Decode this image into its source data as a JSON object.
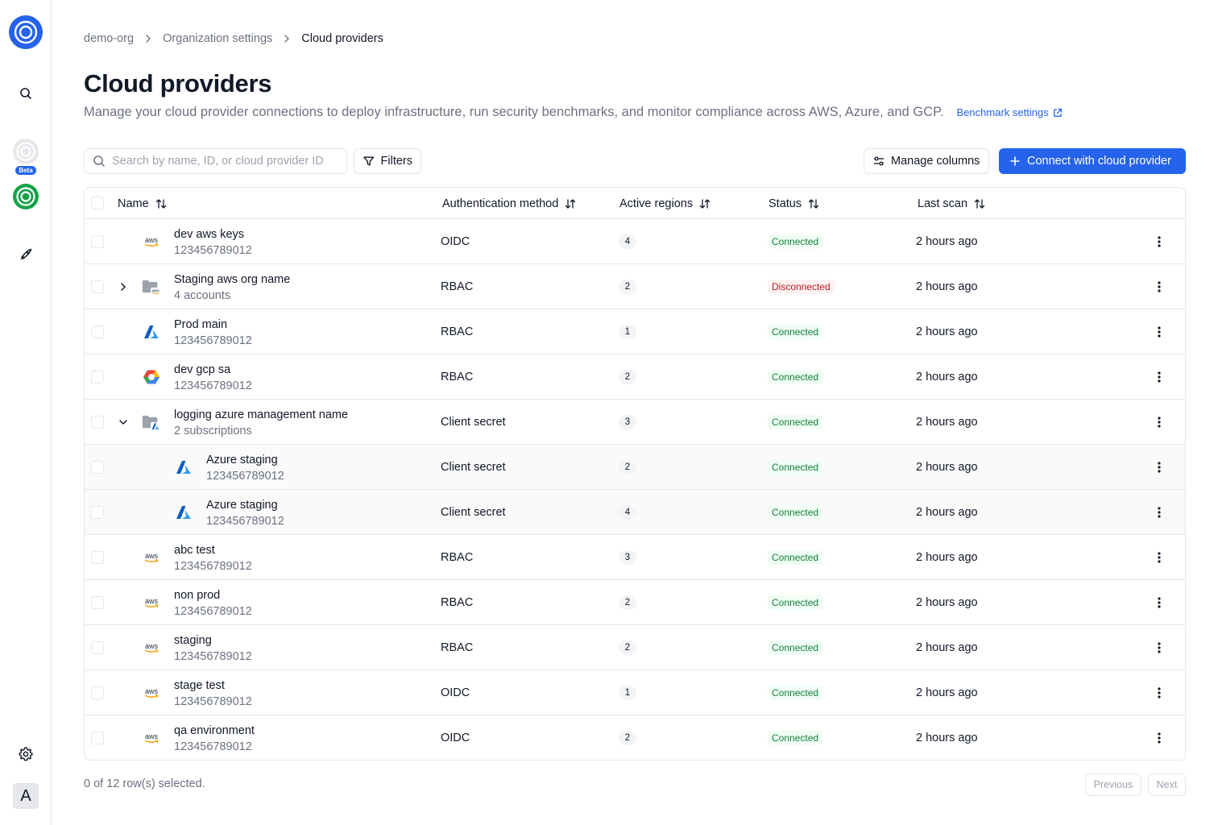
{
  "rail": {
    "beta_label": "Beta",
    "avatar_initial": "A",
    "icons": [
      "logo-icon",
      "search-icon",
      "app-icon",
      "app-icon",
      "rocket-icon",
      "gear-icon"
    ]
  },
  "breadcrumb": [
    "demo-org",
    "Organization settings",
    "Cloud providers"
  ],
  "page": {
    "title": "Cloud providers",
    "description": "Manage your cloud provider connections to deploy infrastructure, run security benchmarks, and monitor compliance across AWS, Azure, and GCP.",
    "benchmark_link": "Benchmark settings"
  },
  "toolbar": {
    "search_placeholder": "Search by name, ID, or cloud provider ID",
    "filters_label": "Filters",
    "manage_columns_label": "Manage columns",
    "connect_label": "Connect with cloud provider"
  },
  "table": {
    "columns": [
      "Name",
      "Authentication method",
      "Active regions",
      "Status",
      "Last scan"
    ],
    "rows": [
      {
        "provider": "aws",
        "name": "dev aws keys",
        "sub": "123456789012",
        "auth": "OIDC",
        "regions": "4",
        "status": "Connected",
        "status_ok": true,
        "scan": "2 hours ago"
      },
      {
        "provider": "aws-org",
        "expand": "collapsed",
        "name": "Staging aws org name",
        "sub": "4 accounts",
        "auth": "RBAC",
        "regions": "2",
        "status": "Disconnected",
        "status_ok": false,
        "scan": "2 hours ago"
      },
      {
        "provider": "azure",
        "name": "Prod main",
        "sub": "123456789012",
        "auth": "RBAC",
        "regions": "1",
        "status": "Connected",
        "status_ok": true,
        "scan": "2 hours ago"
      },
      {
        "provider": "gcp",
        "name": "dev gcp sa",
        "sub": "123456789012",
        "auth": "RBAC",
        "regions": "2",
        "status": "Connected",
        "status_ok": true,
        "scan": "2 hours ago"
      },
      {
        "provider": "azure-org",
        "expand": "expanded",
        "name": "logging azure management name",
        "sub": "2 subscriptions",
        "auth": "Client secret",
        "regions": "3",
        "status": "Connected",
        "status_ok": true,
        "scan": "2 hours ago"
      },
      {
        "provider": "azure",
        "child": true,
        "name": "Azure staging",
        "sub": "123456789012",
        "auth": "Client secret",
        "regions": "2",
        "status": "Connected",
        "status_ok": true,
        "scan": "2 hours ago"
      },
      {
        "provider": "azure",
        "child": true,
        "name": "Azure staging",
        "sub": "123456789012",
        "auth": "Client secret",
        "regions": "4",
        "status": "Connected",
        "status_ok": true,
        "scan": "2 hours ago"
      },
      {
        "provider": "aws",
        "name": "abc test",
        "sub": "123456789012",
        "auth": "RBAC",
        "regions": "3",
        "status": "Connected",
        "status_ok": true,
        "scan": "2 hours ago"
      },
      {
        "provider": "aws",
        "name": "non prod",
        "sub": "123456789012",
        "auth": "RBAC",
        "regions": "2",
        "status": "Connected",
        "status_ok": true,
        "scan": "2 hours ago"
      },
      {
        "provider": "aws",
        "name": "staging",
        "sub": "123456789012",
        "auth": "RBAC",
        "regions": "2",
        "status": "Connected",
        "status_ok": true,
        "scan": "2 hours ago"
      },
      {
        "provider": "aws",
        "name": "stage test",
        "sub": "123456789012",
        "auth": "OIDC",
        "regions": "1",
        "status": "Connected",
        "status_ok": true,
        "scan": "2 hours ago"
      },
      {
        "provider": "aws",
        "name": "qa environment",
        "sub": "123456789012",
        "auth": "OIDC",
        "regions": "2",
        "status": "Connected",
        "status_ok": true,
        "scan": "2 hours ago"
      }
    ]
  },
  "footer": {
    "selection_text": "0 of 12 row(s) selected.",
    "previous_label": "Previous",
    "next_label": "Next"
  },
  "colors": {
    "accent": "#2563eb",
    "connected_bg": "#f0fdf4",
    "connected_text": "#15803d",
    "disconnected_bg": "#fef2f2",
    "disconnected_text": "#b91c1c",
    "app_green": "#16a34a"
  }
}
